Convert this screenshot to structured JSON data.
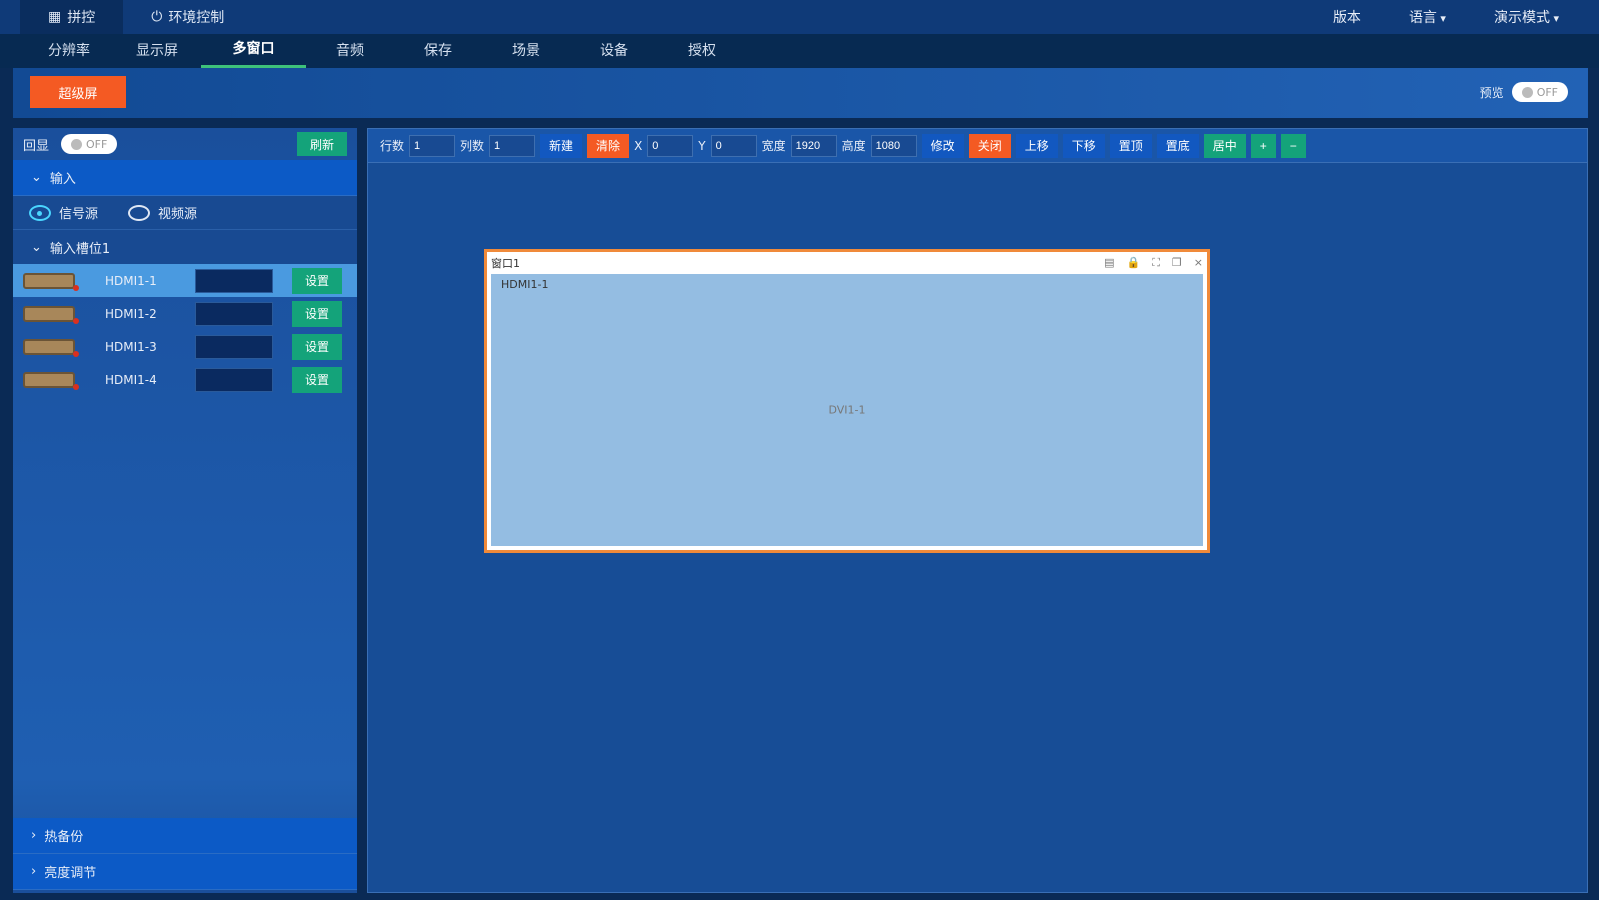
{
  "top": {
    "tabs": [
      {
        "label": "拼控",
        "icon": "grid-icon"
      },
      {
        "label": "环境控制",
        "icon": "power-icon"
      }
    ],
    "right": {
      "version": "版本",
      "language": "语言",
      "mode": "演示模式"
    }
  },
  "nav": {
    "tabs": [
      "分辨率",
      "显示屏",
      "多窗口",
      "音频",
      "保存",
      "场景",
      "设备",
      "授权"
    ],
    "active": "多窗口"
  },
  "bar": {
    "super_button": "超级屏",
    "preview_label": "预览",
    "preview_toggle": "OFF"
  },
  "left": {
    "echo_label": "回显",
    "echo_toggle": "OFF",
    "refresh": "刷新",
    "input_section": "输入",
    "radio_signal": "信号源",
    "radio_video": "视频源",
    "slot_label": "输入槽位1",
    "rows": [
      {
        "name": "HDMI1-1",
        "button": "设置"
      },
      {
        "name": "HDMI1-2",
        "button": "设置"
      },
      {
        "name": "HDMI1-3",
        "button": "设置"
      },
      {
        "name": "HDMI1-4",
        "button": "设置"
      }
    ],
    "hot_backup": "热备份",
    "brightness": "亮度调节"
  },
  "toolbar": {
    "rows_label": "行数",
    "rows": "1",
    "cols_label": "列数",
    "cols": "1",
    "new": "新建",
    "clear": "清除",
    "x_label": "X",
    "x": "0",
    "y_label": "Y",
    "y": "0",
    "width_label": "宽度",
    "width": "1920",
    "height_label": "高度",
    "height": "1080",
    "modify": "修改",
    "close": "关闭",
    "up": "上移",
    "down": "下移",
    "top": "置顶",
    "bottom": "置底",
    "center": "居中",
    "plus": "+",
    "minus": "−"
  },
  "window": {
    "title": "窗口1",
    "source": "HDMI1-1",
    "center_label": "DVI1-1",
    "close": "×"
  },
  "colors": {
    "orange": "#f45a23",
    "green": "#14a37a",
    "bg": "#174d96"
  }
}
